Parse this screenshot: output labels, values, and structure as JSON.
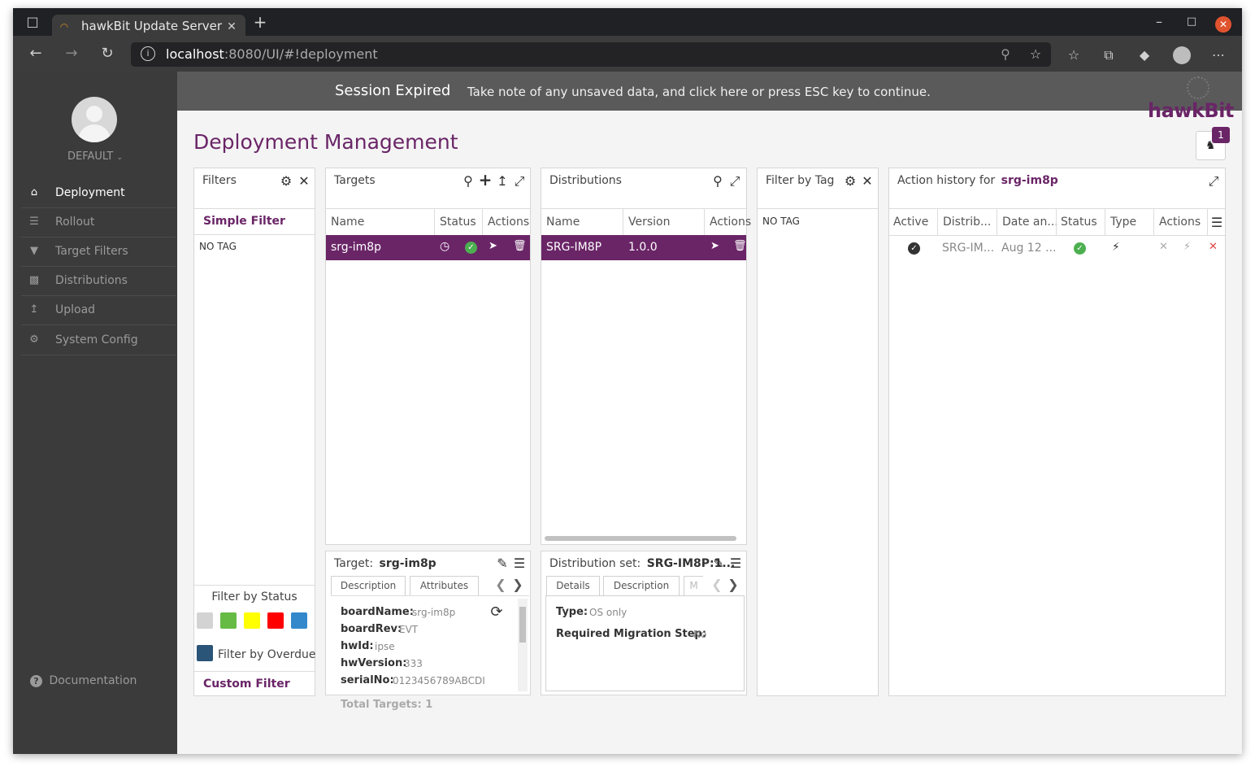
{
  "browser": {
    "tab_title": "hawkBit Update Server",
    "url_host": "localhost",
    "url_rest": ":8080/UI/#!deployment"
  },
  "sidebar": {
    "tenant": "DEFAULT",
    "items": [
      {
        "label": "Deployment",
        "icon": "home-icon"
      },
      {
        "label": "Rollout",
        "icon": "rollout-icon"
      },
      {
        "label": "Target Filters",
        "icon": "filter-icon"
      },
      {
        "label": "Distributions",
        "icon": "briefcase-icon"
      },
      {
        "label": "Upload",
        "icon": "upload-icon"
      },
      {
        "label": "System Config",
        "icon": "gear-icon"
      }
    ],
    "documentation": "Documentation"
  },
  "banner": {
    "title": "Session Expired",
    "message": "Take note of any unsaved data, and click here or press ESC key to continue."
  },
  "logo": "hawkBit",
  "page_title": "Deployment Management",
  "notification_count": "1",
  "filters": {
    "title": "Filters",
    "simple_filter": "Simple Filter",
    "no_tag": "NO TAG",
    "filter_by_status": "Filter by Status",
    "status_colors": [
      "#d3d3d3",
      "#66bb44",
      "#ffff00",
      "#ff0000",
      "#3388cc"
    ],
    "filter_by_overdue": "Filter by Overdue",
    "overdue_color": "#2a5478",
    "custom_filter": "Custom Filter"
  },
  "targets": {
    "title": "Targets",
    "columns": [
      "Name",
      "Status",
      "Actions"
    ],
    "rows": [
      {
        "name": "srg-im8p"
      }
    ],
    "total": "Total Targets: 1"
  },
  "target_details": {
    "label": "Target:",
    "name": "srg-im8p",
    "tabs": [
      "Description",
      "Attributes"
    ],
    "attributes": [
      {
        "key": "boardName:",
        "value": "srg-im8p"
      },
      {
        "key": "boardRev:",
        "value": "EVT"
      },
      {
        "key": "hwId:",
        "value": "ipse"
      },
      {
        "key": "hwVersion:",
        "value": "333"
      },
      {
        "key": "serialNo:",
        "value": "0123456789ABCDI"
      }
    ]
  },
  "distributions": {
    "title": "Distributions",
    "columns": [
      "Name",
      "Version",
      "Actions"
    ],
    "rows": [
      {
        "name": "SRG-IM8P",
        "version": "1.0.0"
      }
    ]
  },
  "distribution_details": {
    "label": "Distribution set:",
    "name": "SRG-IM8P:1...",
    "tabs": [
      "Details",
      "Description",
      "M"
    ],
    "type_key": "Type:",
    "type_value": "OS only",
    "migration_key": "Required Migration Step:",
    "migration_value": "No"
  },
  "filter_by_tag": {
    "title": "Filter by Tag",
    "no_tag": "NO TAG"
  },
  "action_history": {
    "title": "Action history for",
    "target": "srg-im8p",
    "columns": [
      "Active",
      "Distrib...",
      "Date an...",
      "Status",
      "Type",
      "Actions"
    ],
    "rows": [
      {
        "distribution": "SRG-IM...",
        "date": "Aug 12 ..."
      }
    ]
  },
  "colors": {
    "accent": "#6a2567",
    "success": "#4caf50",
    "sidebar_bg": "#3b3b3b"
  }
}
